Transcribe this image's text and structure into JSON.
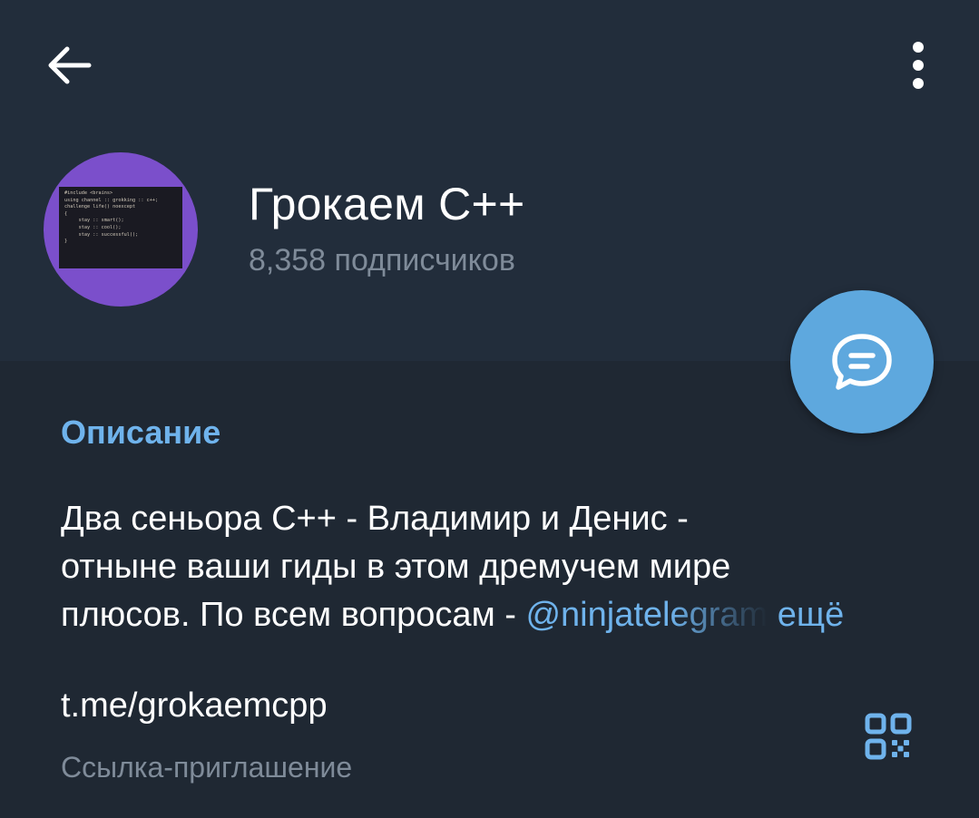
{
  "header": {
    "back_icon": "arrow-left-icon",
    "menu_icon": "more-vertical-icon",
    "channel_title": "Грокаем C++",
    "subscribers": "8,358 подписчиков",
    "avatar_code": "#include <brains>\nusing channel :: grokking :: c++;\nchallenge life() noexcept\n{\n     stay :: smart();\n     stay :: cool();\n     stay :: successful();\n}",
    "fab_icon": "chat-bubble-icon"
  },
  "info": {
    "description_heading": "Описание",
    "description_line1": "Два сеньора C++ - Владимир и Денис -",
    "description_line2": "отныне ваши гиды в этом дремучем мире",
    "description_line3_prefix": "плюсов.  По всем вопросам - ",
    "mention": "@ninjatel",
    "mention_fade": "egram",
    "more": "ещё",
    "link": "t.me/grokaemcpp",
    "link_label": "Ссылка-приглашение",
    "qr_icon": "qr-code-icon"
  },
  "colors": {
    "background": "#1f2833",
    "header_background": "#222d3b",
    "accent": "#6fb3ec",
    "fab": "#5ea8de",
    "avatar": "#7b4fcb",
    "secondary_text": "#7f8b99"
  }
}
